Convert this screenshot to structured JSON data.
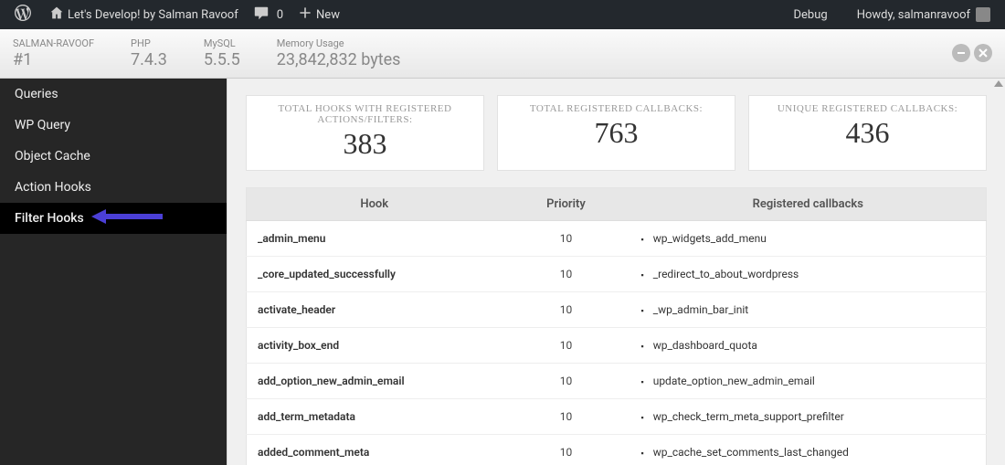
{
  "adminbar": {
    "site_title": "Let's Develop! by Salman Ravoof",
    "comments_count": "0",
    "new_label": "New",
    "debug_label": "Debug",
    "howdy": "Howdy, salmanravoof"
  },
  "header": {
    "stats": [
      {
        "label": "SALMAN-RAVOOF",
        "value": "#1"
      },
      {
        "label": "PHP",
        "value": "7.4.3"
      },
      {
        "label": "MySQL",
        "value": "5.5.5"
      },
      {
        "label": "Memory Usage",
        "value": "23,842,832 bytes"
      }
    ]
  },
  "sidebar": {
    "items": [
      {
        "label": "Queries",
        "active": false
      },
      {
        "label": "WP Query",
        "active": false
      },
      {
        "label": "Object Cache",
        "active": false
      },
      {
        "label": "Action Hooks",
        "active": false
      },
      {
        "label": "Filter Hooks",
        "active": true
      }
    ]
  },
  "summary": {
    "cards": [
      {
        "title": "TOTAL HOOKS WITH REGISTERED ACTIONS/FILTERS:",
        "value": "383"
      },
      {
        "title": "TOTAL REGISTERED CALLBACKS:",
        "value": "763"
      },
      {
        "title": "UNIQUE REGISTERED CALLBACKS:",
        "value": "436"
      }
    ]
  },
  "table": {
    "headers": {
      "hook": "Hook",
      "priority": "Priority",
      "callbacks": "Registered callbacks"
    },
    "rows": [
      {
        "hook": "_admin_menu",
        "priority": "10",
        "callbacks": [
          "wp_widgets_add_menu"
        ]
      },
      {
        "hook": "_core_updated_successfully",
        "priority": "10",
        "callbacks": [
          "_redirect_to_about_wordpress"
        ]
      },
      {
        "hook": "activate_header",
        "priority": "10",
        "callbacks": [
          "_wp_admin_bar_init"
        ]
      },
      {
        "hook": "activity_box_end",
        "priority": "10",
        "callbacks": [
          "wp_dashboard_quota"
        ]
      },
      {
        "hook": "add_option_new_admin_email",
        "priority": "10",
        "callbacks": [
          "update_option_new_admin_email"
        ]
      },
      {
        "hook": "add_term_metadata",
        "priority": "10",
        "callbacks": [
          "wp_check_term_meta_support_prefilter"
        ]
      },
      {
        "hook": "added_comment_meta",
        "priority": "10",
        "callbacks": [
          "wp_cache_set_comments_last_changed"
        ]
      }
    ]
  }
}
